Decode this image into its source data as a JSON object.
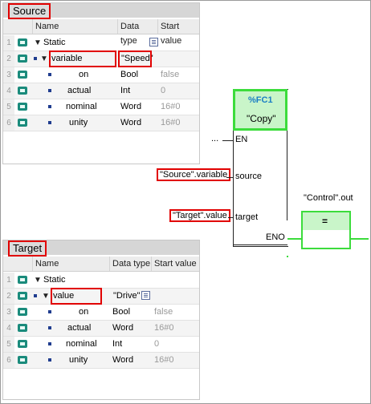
{
  "source": {
    "title": "Source",
    "columns": {
      "name": "Name",
      "type": "Data type",
      "start": "Start value"
    },
    "rows": [
      {
        "num": "1",
        "name": "Static",
        "type": "",
        "start": ""
      },
      {
        "num": "2",
        "name": "variable",
        "type": "\"Speed\"",
        "start": ""
      },
      {
        "num": "3",
        "name": "on",
        "type": "Bool",
        "start": "false"
      },
      {
        "num": "4",
        "name": "actual",
        "type": "Int",
        "start": "0"
      },
      {
        "num": "5",
        "name": "nominal",
        "type": "Word",
        "start": "16#0"
      },
      {
        "num": "6",
        "name": "unity",
        "type": "Word",
        "start": "16#0"
      }
    ]
  },
  "target": {
    "title": "Target",
    "columns": {
      "name": "Name",
      "type": "Data type",
      "start": "Start value"
    },
    "rows": [
      {
        "num": "1",
        "name": "Static",
        "type": "",
        "start": ""
      },
      {
        "num": "2",
        "name": "value",
        "type": "\"Drive\"",
        "start": ""
      },
      {
        "num": "3",
        "name": "on",
        "type": "Bool",
        "start": "false"
      },
      {
        "num": "4",
        "name": "actual",
        "type": "Word",
        "start": "16#0"
      },
      {
        "num": "5",
        "name": "nominal",
        "type": "Int",
        "start": "0"
      },
      {
        "num": "6",
        "name": "unity",
        "type": "Word",
        "start": "16#0"
      }
    ]
  },
  "ladder": {
    "block_id": "%FC1",
    "block_name": "\"Copy\"",
    "en_label": "EN",
    "en_input": "...",
    "source_pin": "source",
    "target_pin": "target",
    "eno_label": "ENO",
    "source_operand": "\"Source\".variable",
    "target_operand": "\"Target\".value",
    "coil_operand": "\"Control\".out",
    "coil_symbol": "="
  },
  "colors": {
    "highlight": "#e10000",
    "active": "#3cdc3c",
    "icon": "#1a8b7c"
  }
}
